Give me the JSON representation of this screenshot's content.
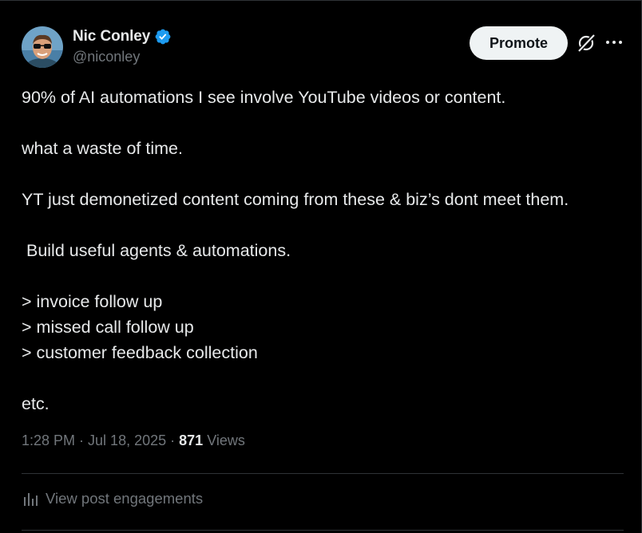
{
  "post": {
    "author": {
      "display_name": "Nic Conley",
      "handle": "@niconley",
      "verified": true,
      "verified_color": "#1d9bf0",
      "avatar_icon": "avatar-photo"
    },
    "actions": {
      "promote_label": "Promote",
      "grok_icon": "grok-icon",
      "more_icon": "more-icon"
    },
    "text_lines": [
      "90% of AI automations I see involve YouTube videos or content.",
      "",
      "what a waste of time.",
      "",
      "YT just demonetized content coming from these & biz’s dont meet them.",
      "",
      " Build useful agents & automations.",
      "",
      "> invoice follow up",
      "> missed call follow up",
      "> customer feedback collection",
      "",
      "etc."
    ],
    "meta": {
      "time": "1:28 PM",
      "separator": " · ",
      "date": "Jul 18, 2025",
      "views_count": "871",
      "views_label": "Views"
    },
    "engagements": {
      "label": "View post engagements",
      "icon": "bar-chart-icon"
    }
  },
  "colors": {
    "background": "#000000",
    "text_primary": "#e7e9ea",
    "text_secondary": "#71767b",
    "divider": "#2f3336",
    "promote_bg": "#eff3f4",
    "promote_text": "#0f1419"
  }
}
